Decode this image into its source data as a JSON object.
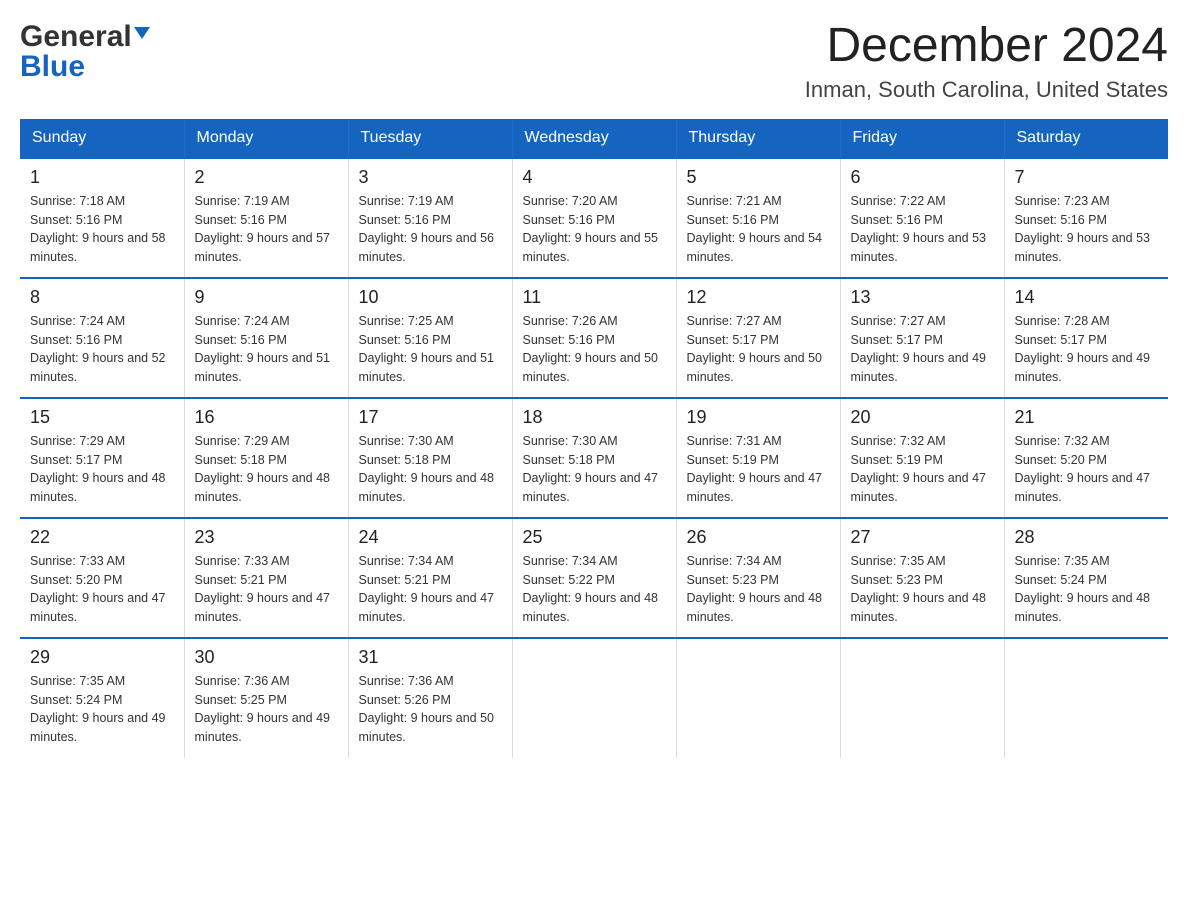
{
  "header": {
    "logo_general": "General",
    "logo_blue": "Blue",
    "month_title": "December 2024",
    "location": "Inman, South Carolina, United States"
  },
  "weekdays": [
    "Sunday",
    "Monday",
    "Tuesday",
    "Wednesday",
    "Thursday",
    "Friday",
    "Saturday"
  ],
  "weeks": [
    [
      {
        "day": "1",
        "sunrise": "7:18 AM",
        "sunset": "5:16 PM",
        "daylight": "9 hours and 58 minutes."
      },
      {
        "day": "2",
        "sunrise": "7:19 AM",
        "sunset": "5:16 PM",
        "daylight": "9 hours and 57 minutes."
      },
      {
        "day": "3",
        "sunrise": "7:19 AM",
        "sunset": "5:16 PM",
        "daylight": "9 hours and 56 minutes."
      },
      {
        "day": "4",
        "sunrise": "7:20 AM",
        "sunset": "5:16 PM",
        "daylight": "9 hours and 55 minutes."
      },
      {
        "day": "5",
        "sunrise": "7:21 AM",
        "sunset": "5:16 PM",
        "daylight": "9 hours and 54 minutes."
      },
      {
        "day": "6",
        "sunrise": "7:22 AM",
        "sunset": "5:16 PM",
        "daylight": "9 hours and 53 minutes."
      },
      {
        "day": "7",
        "sunrise": "7:23 AM",
        "sunset": "5:16 PM",
        "daylight": "9 hours and 53 minutes."
      }
    ],
    [
      {
        "day": "8",
        "sunrise": "7:24 AM",
        "sunset": "5:16 PM",
        "daylight": "9 hours and 52 minutes."
      },
      {
        "day": "9",
        "sunrise": "7:24 AM",
        "sunset": "5:16 PM",
        "daylight": "9 hours and 51 minutes."
      },
      {
        "day": "10",
        "sunrise": "7:25 AM",
        "sunset": "5:16 PM",
        "daylight": "9 hours and 51 minutes."
      },
      {
        "day": "11",
        "sunrise": "7:26 AM",
        "sunset": "5:16 PM",
        "daylight": "9 hours and 50 minutes."
      },
      {
        "day": "12",
        "sunrise": "7:27 AM",
        "sunset": "5:17 PM",
        "daylight": "9 hours and 50 minutes."
      },
      {
        "day": "13",
        "sunrise": "7:27 AM",
        "sunset": "5:17 PM",
        "daylight": "9 hours and 49 minutes."
      },
      {
        "day": "14",
        "sunrise": "7:28 AM",
        "sunset": "5:17 PM",
        "daylight": "9 hours and 49 minutes."
      }
    ],
    [
      {
        "day": "15",
        "sunrise": "7:29 AM",
        "sunset": "5:17 PM",
        "daylight": "9 hours and 48 minutes."
      },
      {
        "day": "16",
        "sunrise": "7:29 AM",
        "sunset": "5:18 PM",
        "daylight": "9 hours and 48 minutes."
      },
      {
        "day": "17",
        "sunrise": "7:30 AM",
        "sunset": "5:18 PM",
        "daylight": "9 hours and 48 minutes."
      },
      {
        "day": "18",
        "sunrise": "7:30 AM",
        "sunset": "5:18 PM",
        "daylight": "9 hours and 47 minutes."
      },
      {
        "day": "19",
        "sunrise": "7:31 AM",
        "sunset": "5:19 PM",
        "daylight": "9 hours and 47 minutes."
      },
      {
        "day": "20",
        "sunrise": "7:32 AM",
        "sunset": "5:19 PM",
        "daylight": "9 hours and 47 minutes."
      },
      {
        "day": "21",
        "sunrise": "7:32 AM",
        "sunset": "5:20 PM",
        "daylight": "9 hours and 47 minutes."
      }
    ],
    [
      {
        "day": "22",
        "sunrise": "7:33 AM",
        "sunset": "5:20 PM",
        "daylight": "9 hours and 47 minutes."
      },
      {
        "day": "23",
        "sunrise": "7:33 AM",
        "sunset": "5:21 PM",
        "daylight": "9 hours and 47 minutes."
      },
      {
        "day": "24",
        "sunrise": "7:34 AM",
        "sunset": "5:21 PM",
        "daylight": "9 hours and 47 minutes."
      },
      {
        "day": "25",
        "sunrise": "7:34 AM",
        "sunset": "5:22 PM",
        "daylight": "9 hours and 48 minutes."
      },
      {
        "day": "26",
        "sunrise": "7:34 AM",
        "sunset": "5:23 PM",
        "daylight": "9 hours and 48 minutes."
      },
      {
        "day": "27",
        "sunrise": "7:35 AM",
        "sunset": "5:23 PM",
        "daylight": "9 hours and 48 minutes."
      },
      {
        "day": "28",
        "sunrise": "7:35 AM",
        "sunset": "5:24 PM",
        "daylight": "9 hours and 48 minutes."
      }
    ],
    [
      {
        "day": "29",
        "sunrise": "7:35 AM",
        "sunset": "5:24 PM",
        "daylight": "9 hours and 49 minutes."
      },
      {
        "day": "30",
        "sunrise": "7:36 AM",
        "sunset": "5:25 PM",
        "daylight": "9 hours and 49 minutes."
      },
      {
        "day": "31",
        "sunrise": "7:36 AM",
        "sunset": "5:26 PM",
        "daylight": "9 hours and 50 minutes."
      },
      null,
      null,
      null,
      null
    ]
  ]
}
